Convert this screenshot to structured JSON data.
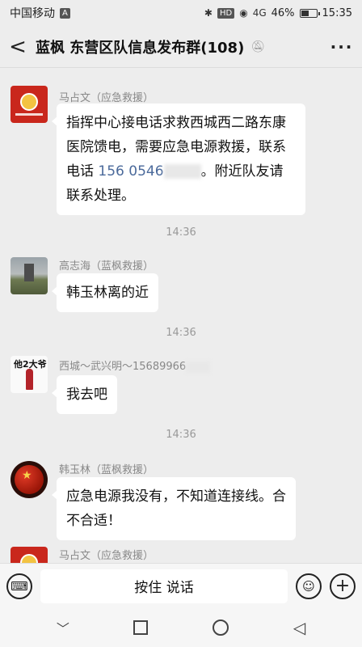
{
  "status": {
    "carrier": "中国移动",
    "badge": "A",
    "network": "HD",
    "signal": "4G",
    "battery": "46%",
    "time": "15:35"
  },
  "header": {
    "back": "<",
    "title": "蓝枫 东营区队信息发布群(108)",
    "mute_icon": "bell-off-icon",
    "more": "···"
  },
  "messages": [
    {
      "sender": "马占文（应急救援）",
      "text_before": "指挥中心接电话求救西城西二路东康医院馈电，需要应急电源救援，联系电话",
      "phone": " 156 0546",
      "text_after": "。附近队友请联系处理。"
    },
    {
      "time": "14:36"
    },
    {
      "sender": "高志海（蓝枫救援）",
      "text": "韩玉林离的近"
    },
    {
      "time": "14:36"
    },
    {
      "sender": "西城～武兴明～15689966",
      "text": "我去吧",
      "avatar_text": "他2大爷"
    },
    {
      "time": "14:36"
    },
    {
      "sender": "韩玉林（蓝枫救援）",
      "text": "应急电源我没有，不知道连接线。合不合适！"
    },
    {
      "sender": "马占文（应急救援）"
    }
  ],
  "input": {
    "voice_label": "按住 说话",
    "keyboard_icon": "keyboard-icon",
    "emoji_icon": "emoji-icon",
    "plus_icon": "plus-icon"
  },
  "nav": {
    "down_icon": "chevron-down-icon",
    "recent_icon": "square-icon",
    "home_icon": "circle-icon",
    "back_icon": "triangle-back-icon"
  }
}
